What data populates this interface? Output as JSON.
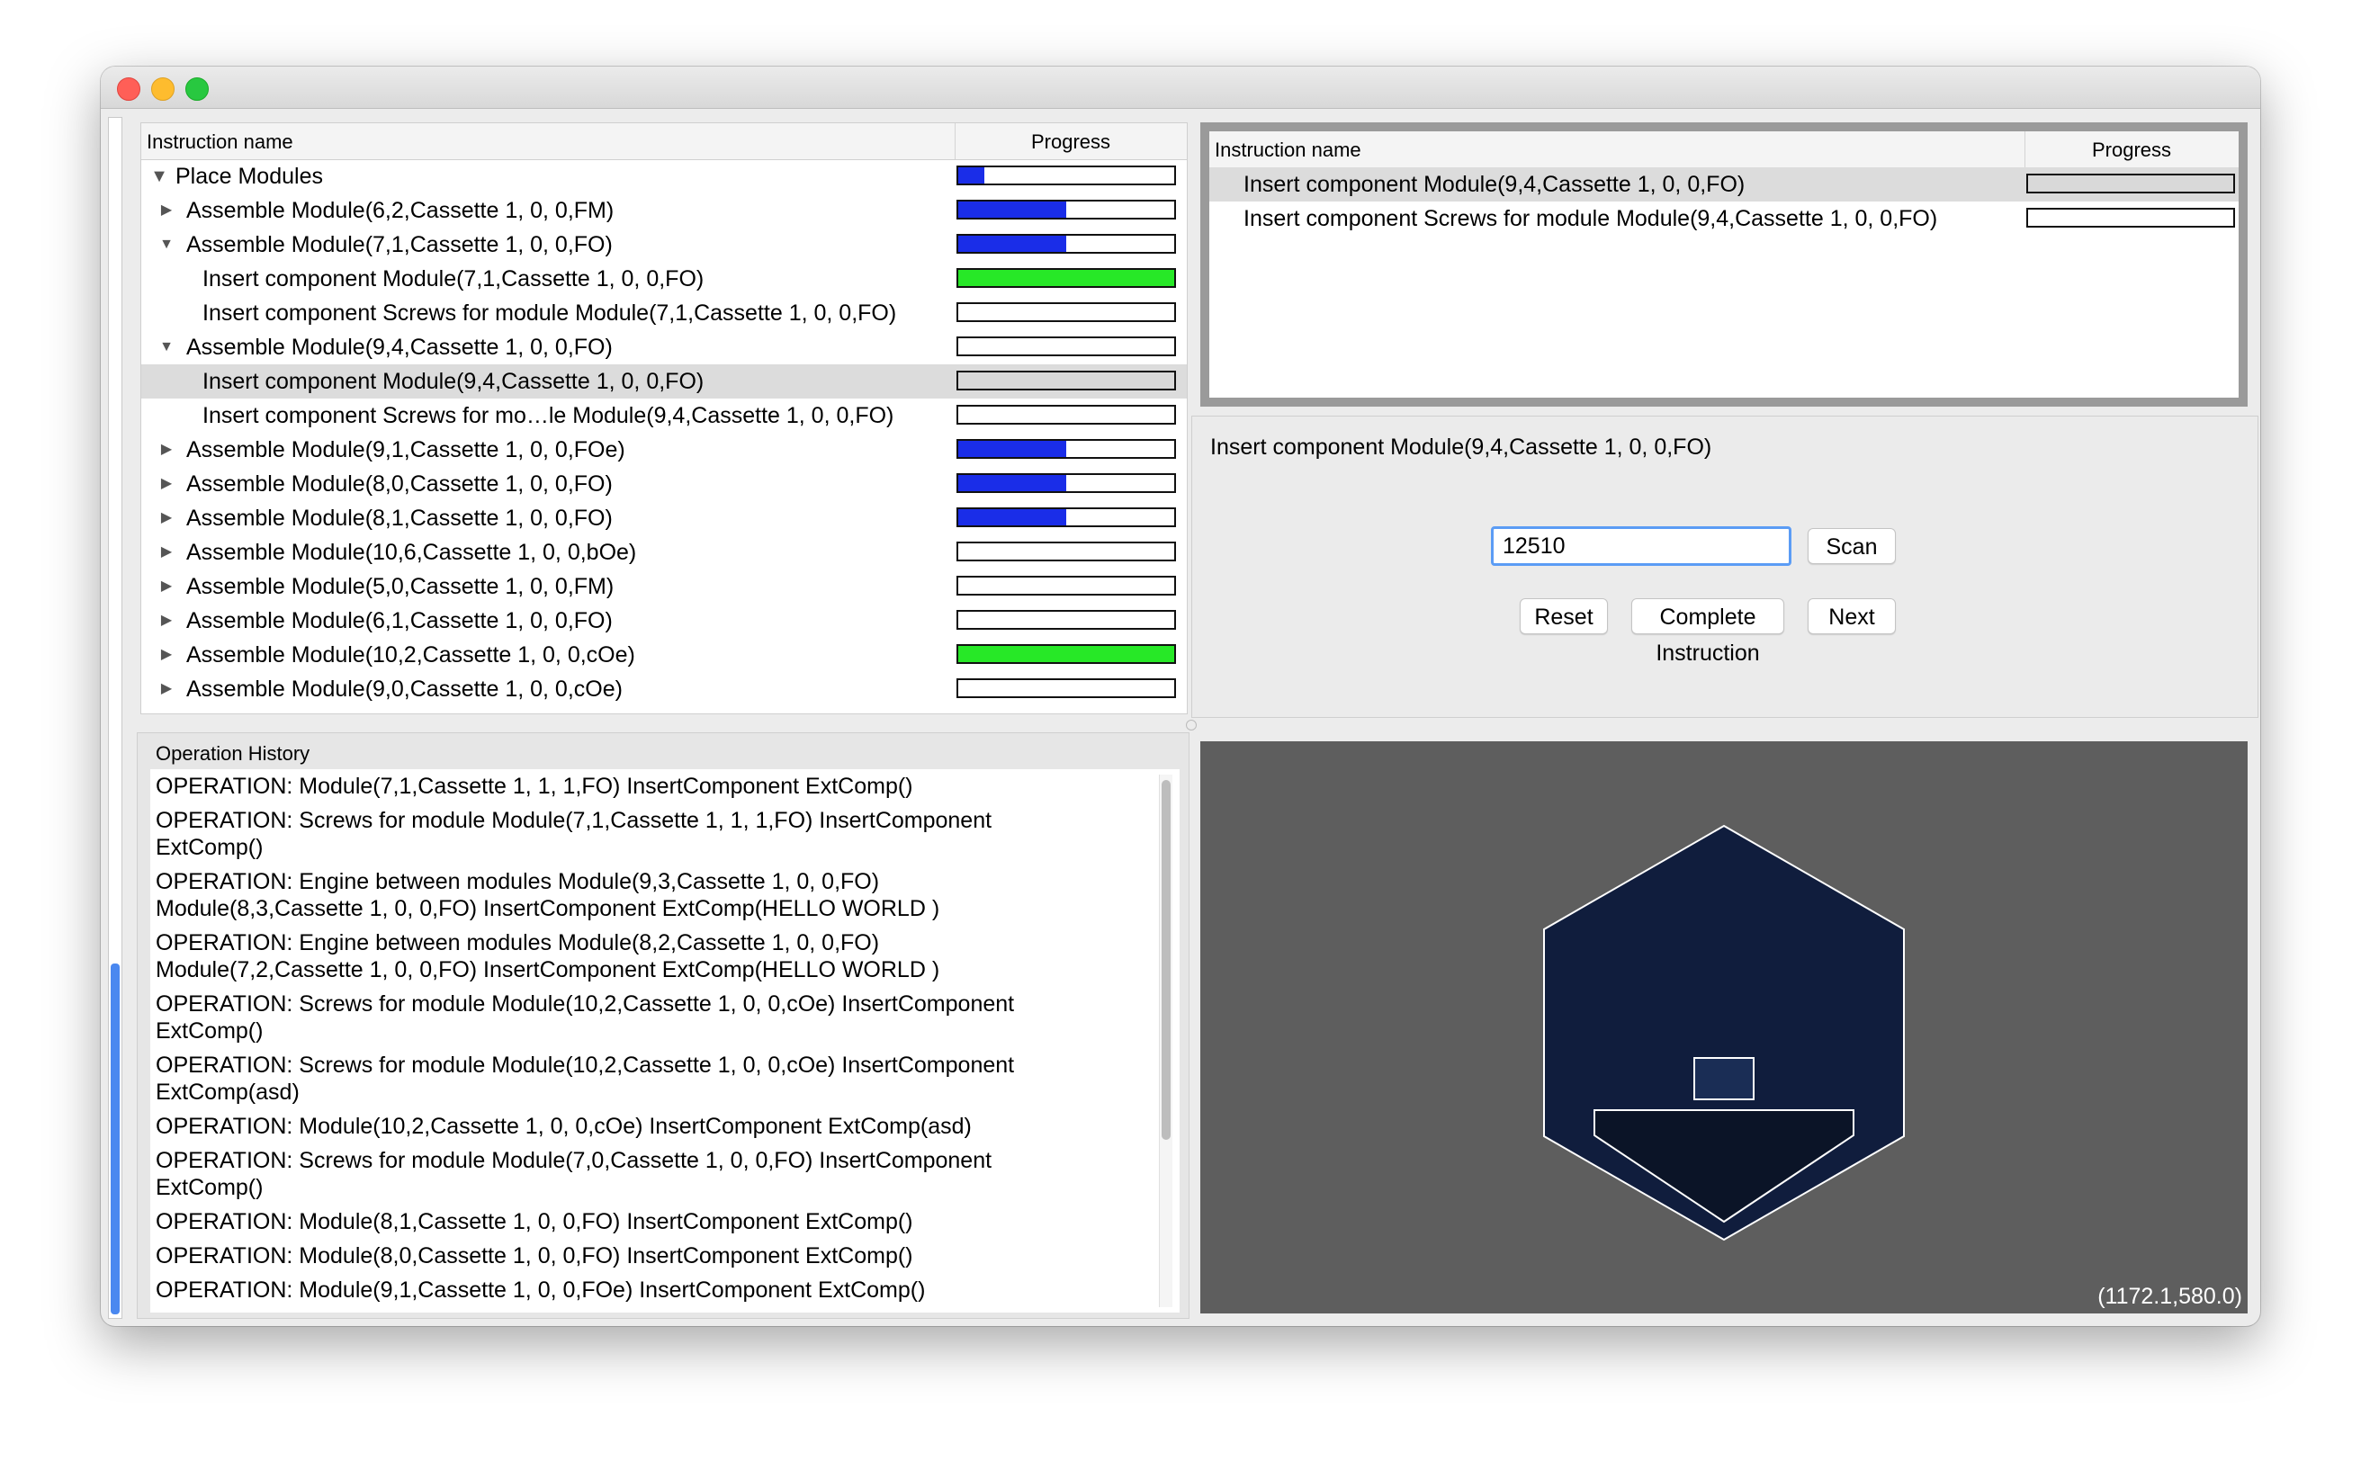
{
  "left_tree": {
    "col_instruction": "Instruction name",
    "col_progress": "Progress",
    "rows": [
      {
        "label": "Place Modules",
        "progress": 0.12,
        "color": "#1a2de8"
      },
      {
        "label": "Assemble Module(6,2,Cassette 1, 0, 0,FM)",
        "progress": 0.5,
        "color": "#1a2de8"
      },
      {
        "label": "Assemble Module(7,1,Cassette 1, 0, 0,FO)",
        "progress": 0.5,
        "color": "#1a2de8"
      },
      {
        "label": "Insert component Module(7,1,Cassette 1, 0, 0,FO)",
        "progress": 1.0,
        "color": "#27e827"
      },
      {
        "label": "Insert component Screws for module Module(7,1,Cassette 1, 0, 0,FO)",
        "progress": 0
      },
      {
        "label": "Assemble Module(9,4,Cassette 1, 0, 0,FO)",
        "progress": 0
      },
      {
        "label": "Insert component Module(9,4,Cassette 1, 0, 0,FO)",
        "progress": 0,
        "selected": true
      },
      {
        "label": "Insert component Screws for mo…le Module(9,4,Cassette 1, 0, 0,FO)",
        "progress": 0
      },
      {
        "label": "Assemble Module(9,1,Cassette 1, 0, 0,FOe)",
        "progress": 0.5,
        "color": "#1a2de8"
      },
      {
        "label": "Assemble Module(8,0,Cassette 1, 0, 0,FO)",
        "progress": 0.5,
        "color": "#1a2de8"
      },
      {
        "label": "Assemble Module(8,1,Cassette 1, 0, 0,FO)",
        "progress": 0.5,
        "color": "#1a2de8"
      },
      {
        "label": "Assemble Module(10,6,Cassette 1, 0, 0,bOe)",
        "progress": 0
      },
      {
        "label": "Assemble Module(5,0,Cassette 1, 0, 0,FM)",
        "progress": 0
      },
      {
        "label": "Assemble Module(6,1,Cassette 1, 0, 0,FO)",
        "progress": 0
      },
      {
        "label": "Assemble Module(10,2,Cassette 1, 0, 0,cOe)",
        "progress": 1.0,
        "color": "#27e827"
      },
      {
        "label": "Assemble Module(9,0,Cassette 1, 0, 0,cOe)",
        "progress": 0
      }
    ]
  },
  "right_table": {
    "col_instruction": "Instruction name",
    "col_progress": "Progress",
    "rows": [
      {
        "label": "Insert component Module(9,4,Cassette 1, 0, 0,FO)",
        "progress": 0,
        "selected": true
      },
      {
        "label": "Insert component Screws for module Module(9,4,Cassette 1, 0, 0,FO)",
        "progress": 0
      }
    ]
  },
  "detail": {
    "title": "Insert component Module(9,4,Cassette 1, 0, 0,FO)",
    "scan_value": "12510",
    "scan_label": "Scan",
    "reset_label": "Reset",
    "complete_label": "Complete Instruction",
    "next_label": "Next"
  },
  "history": {
    "label": "Operation History",
    "entries": [
      [
        "OPERATION: Module(7,1,Cassette 1, 1, 1,FO) InsertComponent ExtComp()"
      ],
      [
        "OPERATION: Screws for module Module(7,1,Cassette 1, 1, 1,FO) InsertComponent",
        "ExtComp()"
      ],
      [
        "OPERATION: Engine between modules Module(9,3,Cassette 1, 0, 0,FO)",
        "Module(8,3,Cassette 1, 0, 0,FO) InsertComponent ExtComp(HELLO WORLD )"
      ],
      [
        "OPERATION: Engine between modules Module(8,2,Cassette 1, 0, 0,FO)",
        "Module(7,2,Cassette 1, 0, 0,FO) InsertComponent ExtComp(HELLO WORLD )"
      ],
      [
        "OPERATION: Screws for module Module(10,2,Cassette 1, 0, 0,cOe) InsertComponent",
        "ExtComp()"
      ],
      [
        "OPERATION: Screws for module Module(10,2,Cassette 1, 0, 0,cOe) InsertComponent",
        "ExtComp(asd)"
      ],
      [
        "OPERATION: Module(10,2,Cassette 1, 0, 0,cOe) InsertComponent ExtComp(asd)"
      ],
      [
        "OPERATION: Screws for module Module(7,0,Cassette 1, 0, 0,FO) InsertComponent",
        "ExtComp()"
      ],
      [
        "OPERATION: Module(8,1,Cassette 1, 0, 0,FO) InsertComponent ExtComp()"
      ],
      [
        "OPERATION: Module(8,0,Cassette 1, 0, 0,FO) InsertComponent ExtComp()"
      ],
      [
        "OPERATION: Module(9,1,Cassette 1, 0, 0,FOe) InsertComponent ExtComp()"
      ]
    ]
  },
  "canvas": {
    "coordinates": "(1172.1,580.0)",
    "background": "#5e5e5e",
    "hex_fill": "#101d3d",
    "cutout_fill": "#0b1427"
  }
}
